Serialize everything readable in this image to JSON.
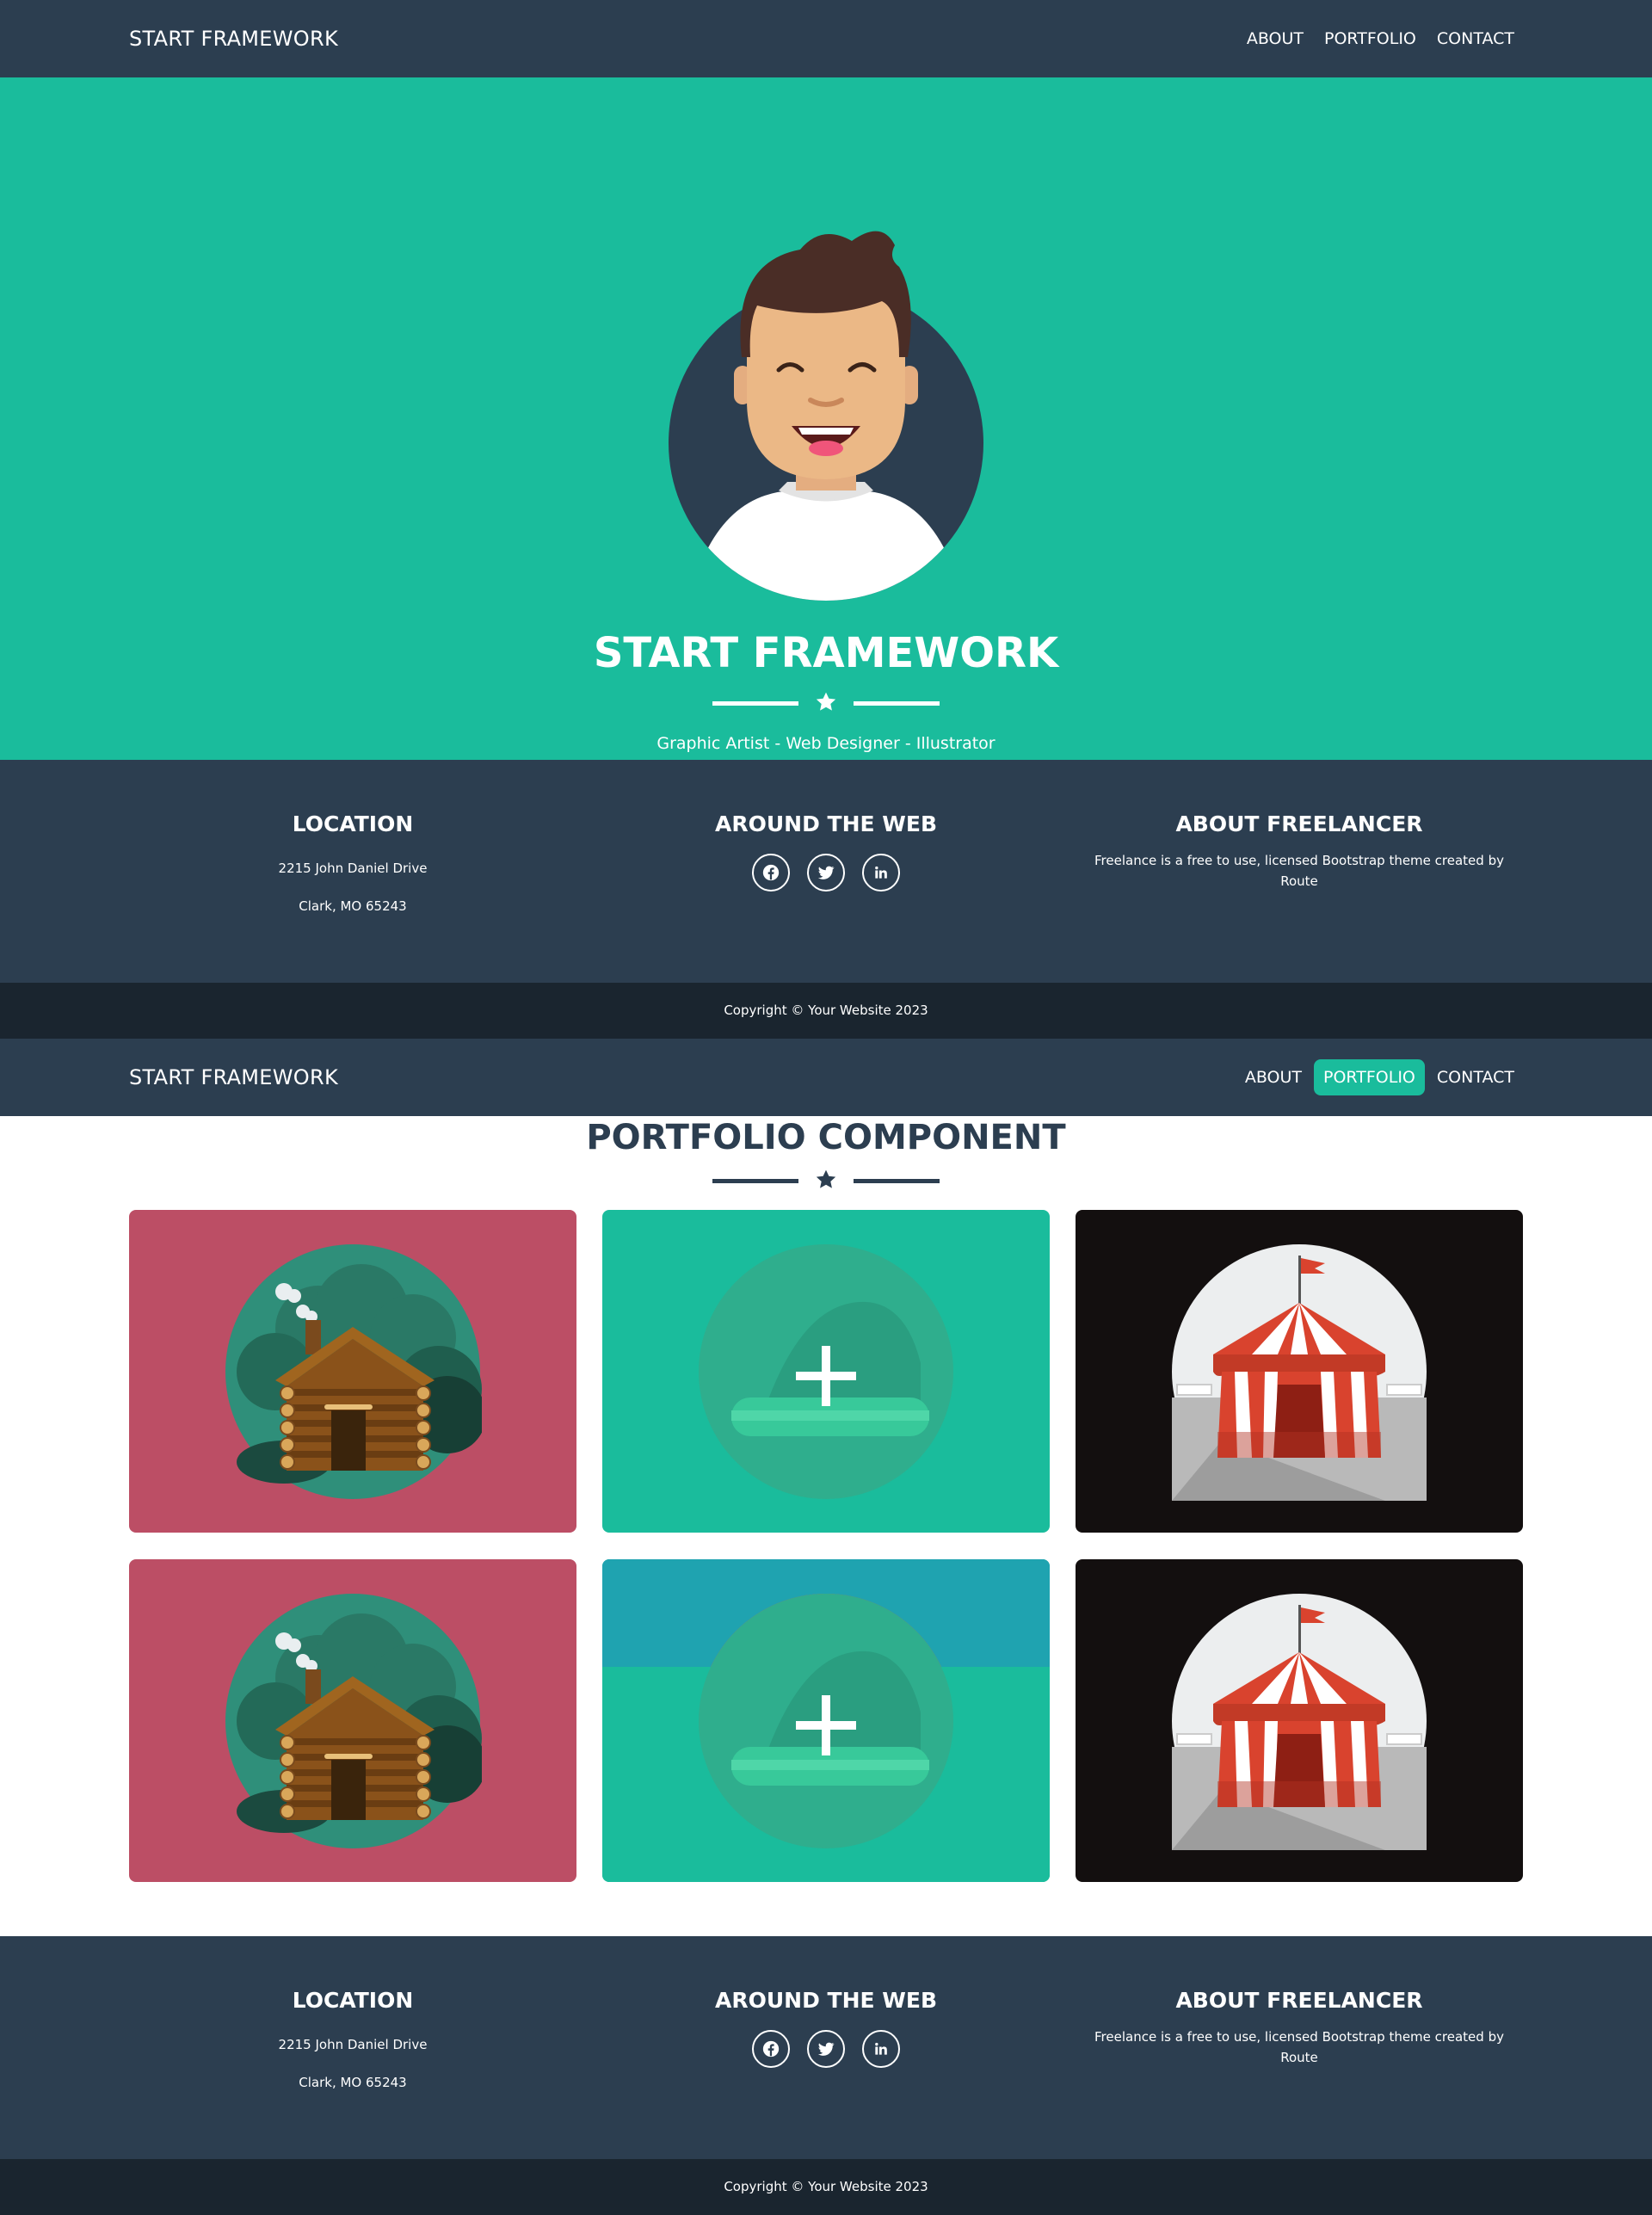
{
  "nav": {
    "brand": "START FRAMEWORK",
    "links": [
      "ABOUT",
      "PORTFOLIO",
      "CONTACT"
    ]
  },
  "hero": {
    "title": "START FRAMEWORK",
    "subtitle": "Graphic Artist - Web Designer - Illustrator",
    "avatar_icon": "avatar-icon",
    "divider_icon": "star-icon"
  },
  "footer": {
    "location_title": "LOCATION",
    "address_line1": "2215 John Daniel Drive",
    "address_line2": "Clark, MO 65243",
    "web_title": "AROUND THE WEB",
    "social_icons": [
      "facebook-icon",
      "twitter-icon",
      "linkedin-icon"
    ],
    "about_title": "ABOUT FREELANCER",
    "about_text": "Freelance is a free to use, licensed Bootstrap theme created by Route"
  },
  "copyright": "Copyright © Your Website 2023",
  "portfolio": {
    "title": "PORTFOLIO COMPONENT",
    "active_link": "PORTFOLIO",
    "items": [
      {
        "image": "cabin",
        "bg": "#bc4e65"
      },
      {
        "image": "cake-hover",
        "bg": "#1abc9c"
      },
      {
        "image": "circus",
        "bg": "#130f0f"
      },
      {
        "image": "cabin",
        "bg": "#bc4e65"
      },
      {
        "image": "cake-hover",
        "bg": "#1abc9c"
      },
      {
        "image": "circus",
        "bg": "#130f0f"
      }
    ]
  },
  "colors": {
    "primary": "#1abc9c",
    "dark": "#2c3e50",
    "darker": "#1a252f"
  }
}
